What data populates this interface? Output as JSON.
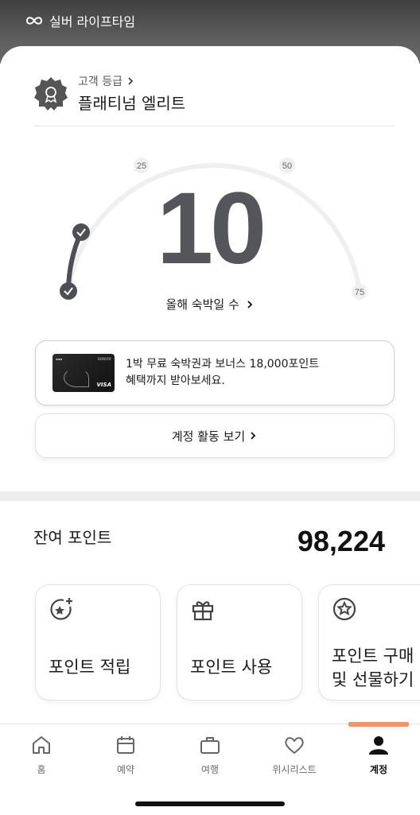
{
  "header": {
    "tier_title": "실버 라이프타임"
  },
  "grade": {
    "label": "고객 등급",
    "name": "플래티넘 엘리트"
  },
  "gauge": {
    "nights_count": "10",
    "ticks": [
      "25",
      "50",
      "75"
    ],
    "nights_label": "올해 숙박일 수"
  },
  "promo": {
    "card_brand": "BONVOY",
    "card_network": "VISA",
    "line1": "1박 무료 숙박권과 보너스 18,000포인트",
    "line2": "혜택까지 받아보세요."
  },
  "account_activity_button": "계정 활동 보기",
  "points": {
    "label": "잔여 포인트",
    "value": "98,224"
  },
  "tiles": [
    {
      "label": "포인트 적립",
      "icon": "star-plus-icon"
    },
    {
      "label": "포인트 사용",
      "icon": "gift-icon"
    },
    {
      "label_line1": "포인트 구매",
      "label_line2": "및 선물하기",
      "icon": "star-circle-icon"
    }
  ],
  "nav": [
    {
      "label": "홈",
      "icon": "home-icon"
    },
    {
      "label": "예약",
      "icon": "calendar-icon"
    },
    {
      "label": "여행",
      "icon": "suitcase-icon"
    },
    {
      "label": "위시리스트",
      "icon": "heart-icon"
    },
    {
      "label": "계정",
      "icon": "person-icon",
      "active": true
    }
  ],
  "colors": {
    "accent": "#f0946b",
    "gauge_track": "#efefef",
    "gauge_fill": "#4e4f54"
  }
}
